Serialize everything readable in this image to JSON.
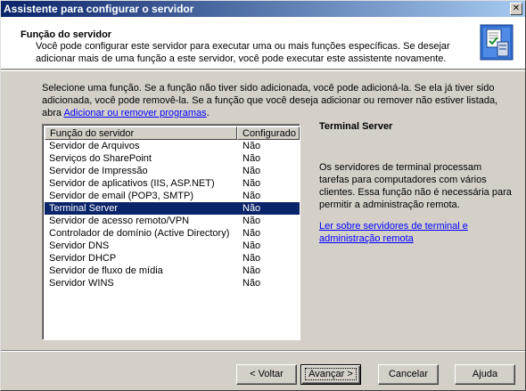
{
  "window": {
    "title": "Assistente para configurar o servidor",
    "close_glyph": "✕"
  },
  "header": {
    "title": "Função do servidor",
    "subtitle": "Você pode configurar este servidor para executar uma ou mais funções específicas. Se desejar adicionar mais de uma função a este servidor, você pode executar este assistente novamente.",
    "icon": "server-config-icon"
  },
  "intro": {
    "text": "Selecione uma função. Se a função não tiver sido adicionada, você pode adicioná-la. Se ela já tiver sido adicionada, você pode removê-la. Se a função que você deseja adicionar ou remover não estiver listada, abra ",
    "link": "Adicionar ou remover programas",
    "suffix": "."
  },
  "roles": {
    "columns": [
      "Função do servidor",
      "Configurado"
    ],
    "rows": [
      {
        "name": "Servidor de Arquivos",
        "configured": "Não",
        "selected": false
      },
      {
        "name": "Serviços do SharePoint",
        "configured": "Não",
        "selected": false
      },
      {
        "name": "Servidor de Impressão",
        "configured": "Não",
        "selected": false
      },
      {
        "name": "Servidor de aplicativos (IIS, ASP.NET)",
        "configured": "Não",
        "selected": false
      },
      {
        "name": "Servidor de email (POP3, SMTP)",
        "configured": "Não",
        "selected": false
      },
      {
        "name": "Terminal Server",
        "configured": "Não",
        "selected": true
      },
      {
        "name": "Servidor de acesso remoto/VPN",
        "configured": "Não",
        "selected": false
      },
      {
        "name": "Controlador de domínio (Active Directory)",
        "configured": "Não",
        "selected": false
      },
      {
        "name": "Servidor DNS",
        "configured": "Não",
        "selected": false
      },
      {
        "name": "Servidor DHCP",
        "configured": "Não",
        "selected": false
      },
      {
        "name": "Servidor de fluxo de mídia",
        "configured": "Não",
        "selected": false
      },
      {
        "name": "Servidor WINS",
        "configured": "Não",
        "selected": false
      }
    ]
  },
  "detail": {
    "title": "Terminal Server",
    "description": "Os servidores de terminal processam tarefas para computadores com vários clientes. Essa função não é necessária para permitir a administração remota.",
    "link": "Ler sobre servidores de terminal e administração remota"
  },
  "buttons": {
    "back": "< Voltar",
    "next": "Avançar >",
    "cancel": "Cancelar",
    "help": "Ajuda"
  },
  "colors": {
    "selection": "#0a246a",
    "link": "#0000ff",
    "face": "#d4d0c8"
  }
}
